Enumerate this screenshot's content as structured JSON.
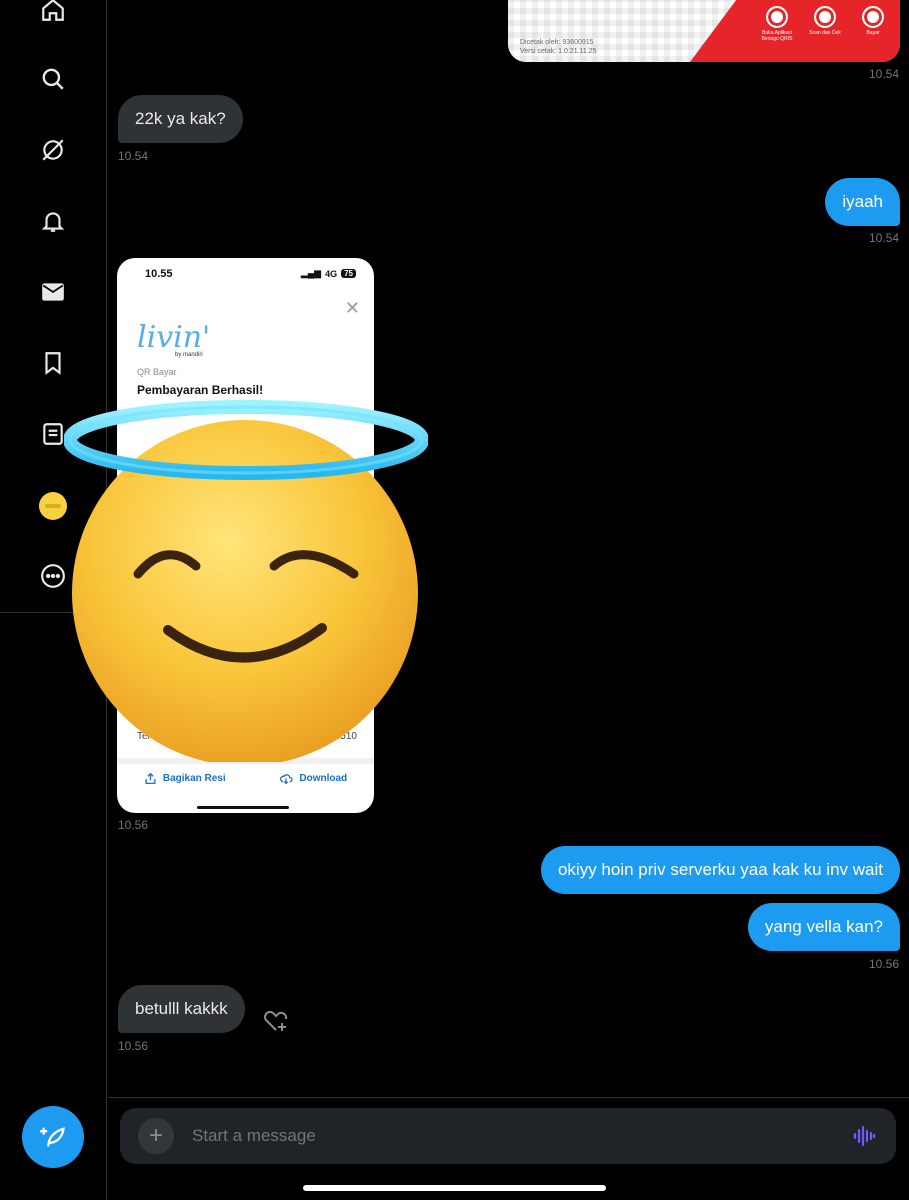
{
  "colors": {
    "accent": "#1d9bf0",
    "incoming_bubble": "#2f3336",
    "background": "#000000"
  },
  "sidebar": {
    "items": [
      {
        "name": "home",
        "icon": "home-icon"
      },
      {
        "name": "search",
        "icon": "search-icon"
      },
      {
        "name": "grok",
        "icon": "grok-icon"
      },
      {
        "name": "notifications",
        "icon": "bell-icon"
      },
      {
        "name": "messages",
        "icon": "mail-icon"
      },
      {
        "name": "bookmarks",
        "icon": "bookmark-icon"
      },
      {
        "name": "lists",
        "icon": "list-icon"
      },
      {
        "name": "profile",
        "icon": "avatar"
      },
      {
        "name": "more",
        "icon": "more-icon"
      }
    ],
    "compose_icon": "compose-icon"
  },
  "top_image": {
    "printed_by": "Dicetak oleh: 93600915",
    "version": "Versi cetak: 1.0.21.11.25",
    "steps": [
      "Buka Aplikasi Berlogo QRIS",
      "Scan dan Cek",
      "Bayar"
    ],
    "time": "10.54"
  },
  "messages": [
    {
      "id": "m1",
      "direction": "in",
      "text": "22k ya kak?",
      "time": "10.54"
    },
    {
      "id": "m2",
      "direction": "out",
      "text": "iyaah",
      "time": "10.54"
    },
    {
      "id": "m3",
      "direction": "in",
      "type": "image",
      "time": "10.56"
    },
    {
      "id": "m4",
      "direction": "out",
      "text": "okiyy hoin priv serverku yaa kak ku inv wait"
    },
    {
      "id": "m5",
      "direction": "out",
      "text": "yang vella kan?",
      "time": "10.56"
    },
    {
      "id": "m6",
      "direction": "in",
      "text": "betulll kakkk",
      "time": "10.56"
    }
  ],
  "screenshot": {
    "status_time": "10.55",
    "network": "4G",
    "battery": "75",
    "app_name": "livin'",
    "app_by": "by mandiri",
    "subtitle": "QR Bayar",
    "title": "Pembayaran Berhasil!",
    "row_left": "Ter",
    "row_right": "3510",
    "share_label": "Bagikan Resi",
    "download_label": "Download",
    "overlay_emoji": "smiling face with halo"
  },
  "composer": {
    "placeholder": "Start a message",
    "add_icon": "plus-icon",
    "voice_icon": "voice-icon"
  }
}
